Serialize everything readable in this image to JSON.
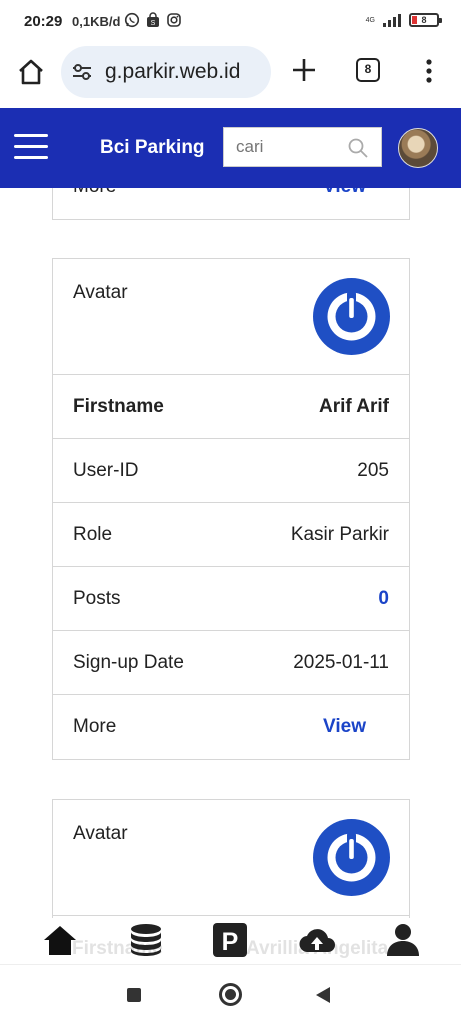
{
  "status_bar": {
    "time": "20:29",
    "speed": "0,1KB/d",
    "network": "4G",
    "battery": "8"
  },
  "browser": {
    "url": "g.parkir.web.id",
    "tab_count": "8"
  },
  "app_header": {
    "brand": "Bci Parking",
    "search_placeholder": "cari"
  },
  "cards": [
    {
      "partial_more_label": "More",
      "partial_view_label": "View"
    },
    {
      "avatar_label": "Avatar",
      "firstname_label": "Firstname",
      "firstname_value": "Arif Arif",
      "userid_label": "User-ID",
      "userid_value": "205",
      "role_label": "Role",
      "role_value": "Kasir Parkir",
      "posts_label": "Posts",
      "posts_value": "0",
      "signup_label": "Sign-up Date",
      "signup_value": "2025-01-11",
      "more_label": "More",
      "view_label": "View"
    },
    {
      "avatar_label": "Avatar",
      "firstname_label": "Firstname",
      "firstname_value": "Avrillia Angelita"
    }
  ],
  "bottom_nav": {
    "items": [
      "home-icon",
      "database-icon",
      "parking-icon",
      "cloud-upload-icon",
      "user-icon"
    ]
  },
  "colors": {
    "header_bg": "#1b2eb3",
    "link_blue": "#1b44c8",
    "logo_blue": "#1f4fc4"
  }
}
